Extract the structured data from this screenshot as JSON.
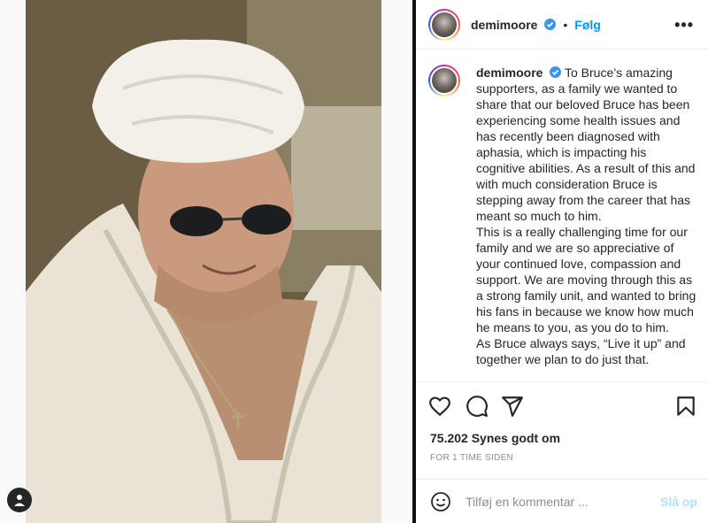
{
  "post": {
    "username": "demimoore",
    "follow_label": "Følg",
    "dot": "•",
    "more_label": "•••",
    "caption": {
      "username": "demimoore",
      "paragraphs": [
        "To Bruce’s amazing supporters, as a family we wanted to share that our beloved Bruce has been experiencing some health issues and has recently been diagnosed with aphasia, which is impacting his cognitive abilities. As a result of this and with much consideration Bruce is stepping away from the career that has meant so much to him.",
        "This is a really challenging time for our family and we are so appreciative of your continued love, compassion and support. We are moving through this as a strong family unit, and wanted to bring his fans in because we know how much he means to you, as you do to him.",
        "As Bruce always says, “Live it up” and together we plan to do just that."
      ]
    },
    "likes": "75.202 Synes godt om",
    "timestamp": "FOR 1 TIME SIDEN"
  },
  "comment": {
    "placeholder": "Tilføj en kommentar ...",
    "post_label": "Slå op"
  },
  "colors": {
    "accent": "#0095f6",
    "post_disabled": "#b2dffc",
    "verified": "#3897f0"
  },
  "icons": [
    "tag-icon",
    "verified-icon",
    "heart-icon",
    "comment-icon",
    "share-icon",
    "bookmark-icon",
    "emoji-icon"
  ]
}
